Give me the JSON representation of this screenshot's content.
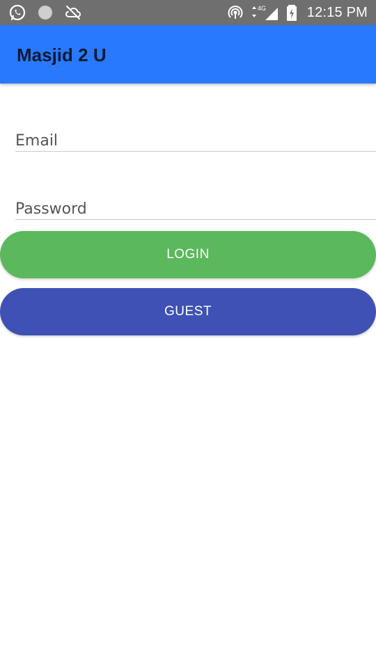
{
  "status_bar": {
    "time": "12:15 PM",
    "network_label": "4G",
    "left_icons": [
      "whatsapp-icon",
      "circle-notification-icon",
      "cloud-off-icon"
    ],
    "right_icons": [
      "hotspot-icon",
      "data-arrows-icon",
      "signal-icon",
      "battery-charging-icon"
    ]
  },
  "app_bar": {
    "title": "Masjid 2 U",
    "color": "#2979ff"
  },
  "form": {
    "email_placeholder": "Email",
    "email_value": "",
    "password_placeholder": "Password",
    "password_value": ""
  },
  "buttons": {
    "login_label": "LOGIN",
    "login_color": "#5cb85c",
    "guest_label": "GUEST",
    "guest_color": "#3f51b5"
  }
}
